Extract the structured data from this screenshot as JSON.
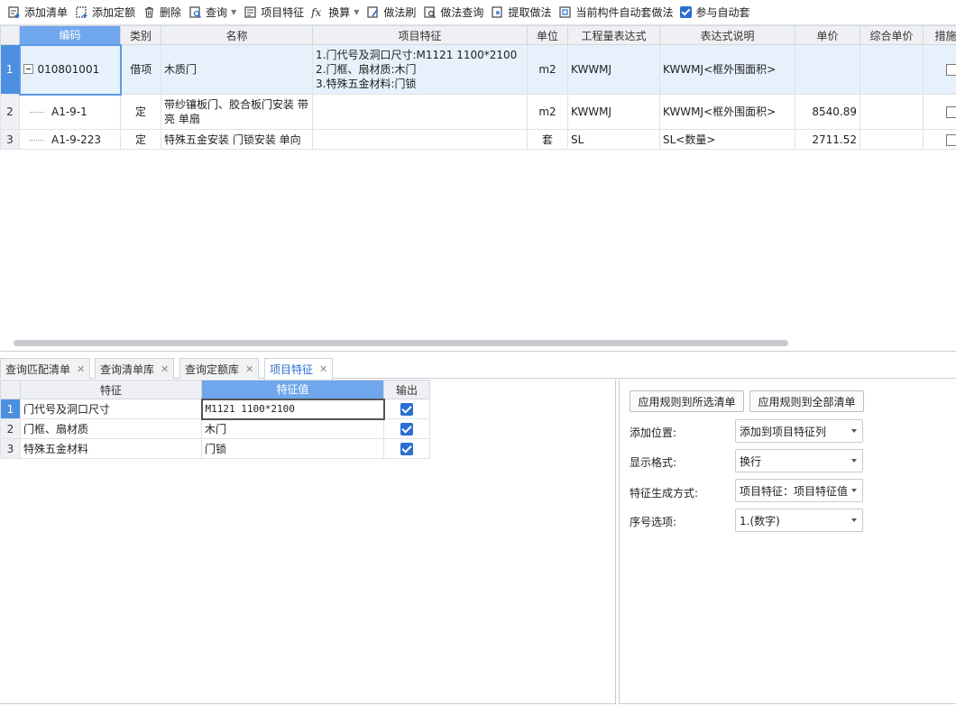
{
  "toolbar": {
    "add_list": "添加清单",
    "add_quota": "添加定额",
    "delete": "删除",
    "query": "查询",
    "item_feature": "项目特征",
    "convert": "换算",
    "method_brush": "做法刷",
    "method_query": "做法查询",
    "extract_method": "提取做法",
    "auto_method": "当前构件自动套做法",
    "join_auto": "参与自动套"
  },
  "main_table": {
    "headers": [
      "编码",
      "类别",
      "名称",
      "项目特征",
      "单位",
      "工程量表达式",
      "表达式说明",
      "单价",
      "综合单价",
      "措施项"
    ],
    "rows": [
      {
        "rn": "1",
        "code": "010801001",
        "category": "借项",
        "name": "木质门",
        "feature_lines": [
          "1.门代号及洞口尺寸:M1121 1100*2100",
          "2.门框、扇材质:木门",
          "3.特殊五金材料:门锁"
        ],
        "unit": "m2",
        "expr": "KWWMJ",
        "expr_desc": "KWWMJ<框外围面积>",
        "price": "",
        "comp_price": ""
      },
      {
        "rn": "2",
        "code": "A1-9-1",
        "category": "定",
        "name": "带纱镶板门、胶合板门安装 带亮 单扇",
        "feature_lines": [],
        "unit": "m2",
        "expr": "KWWMJ",
        "expr_desc": "KWWMJ<框外围面积>",
        "price": "8540.89",
        "comp_price": ""
      },
      {
        "rn": "3",
        "code": "A1-9-223",
        "category": "定",
        "name": "特殊五金安装 门锁安装 单向",
        "feature_lines": [],
        "unit": "套",
        "expr": "SL",
        "expr_desc": "SL<数量>",
        "price": "2711.52",
        "comp_price": ""
      }
    ]
  },
  "tabs": [
    "查询匹配清单",
    "查询清单库",
    "查询定额库",
    "项目特征"
  ],
  "feature_table": {
    "headers": [
      "特征",
      "特征值",
      "输出"
    ],
    "rows": [
      {
        "rn": "1",
        "feature": "门代号及洞口尺寸",
        "value": "M1121 1100*2100",
        "output": true
      },
      {
        "rn": "2",
        "feature": "门框、扇材质",
        "value": "木门",
        "output": true
      },
      {
        "rn": "3",
        "feature": "特殊五金材料",
        "value": "门锁",
        "output": true
      }
    ]
  },
  "settings": {
    "apply_selected": "应用规则到所选清单",
    "apply_all": "应用规则到全部清单",
    "add_position_label": "添加位置:",
    "add_position_value": "添加到项目特征列",
    "display_format_label": "显示格式:",
    "display_format_value": "换行",
    "generate_mode_label": "特征生成方式:",
    "generate_mode_value": "项目特征：项目特征值",
    "seq_option_label": "序号选项:",
    "seq_option_value": "1.(数字)"
  },
  "colors": {
    "accent": "#2a6fd1",
    "header_selected": "#70a7ec",
    "row_selected": "#e6f1fc"
  }
}
